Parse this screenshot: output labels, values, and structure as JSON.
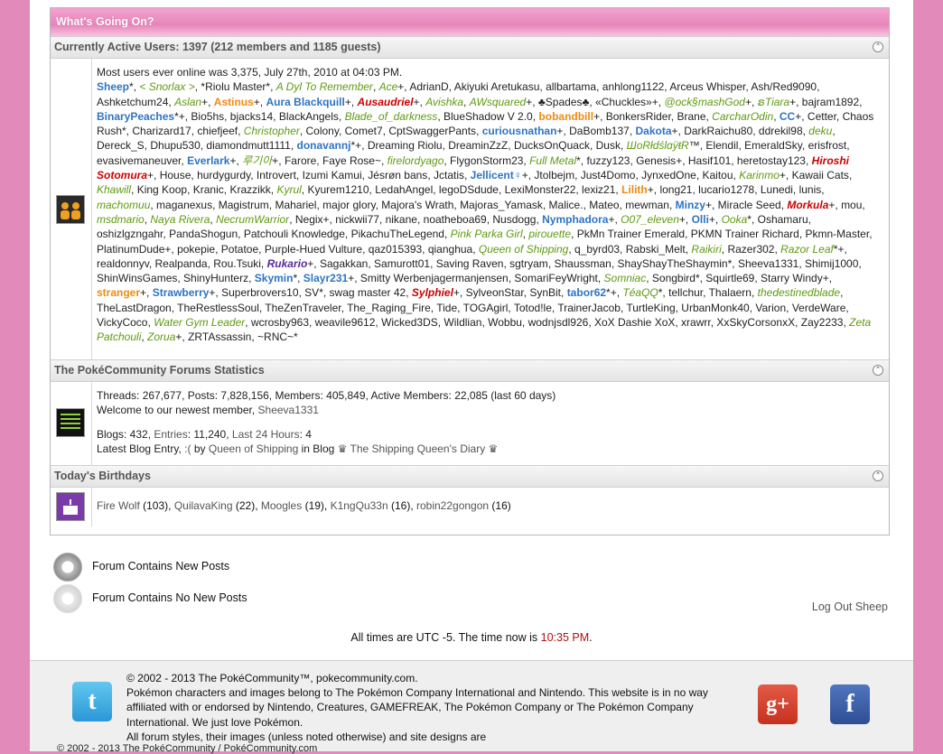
{
  "whats_going_on": {
    "title": "What's Going On?"
  },
  "active_users": {
    "header": "Currently Active Users: 1397 (212 members and 1185 guests)",
    "most_ever": "Most users ever online was 3,375, July 27th, 2010 at 04:03 PM.",
    "users": [
      {
        "t": "Sheep",
        "c": "b",
        "s": "*, "
      },
      {
        "t": "< Snorlax >",
        "c": "g",
        "s": ", "
      },
      {
        "t": "*Riolu Master*",
        "c": "",
        "s": ", "
      },
      {
        "t": "A Dyl To Remember",
        "c": "g",
        "s": ", "
      },
      {
        "t": "Ace",
        "c": "g",
        "s": "+, "
      },
      {
        "t": "AdrianD",
        "c": "",
        "s": ", "
      },
      {
        "t": "Akiyuki Aretukasu",
        "c": "",
        "s": ", "
      },
      {
        "t": "allbartama",
        "c": "",
        "s": ", "
      },
      {
        "t": "anhlong1122",
        "c": "",
        "s": ", "
      },
      {
        "t": "Arceus Whisper",
        "c": "",
        "s": ", "
      },
      {
        "t": "Ash/Red9090",
        "c": "",
        "s": ", "
      },
      {
        "t": "Ashketchum24",
        "c": "",
        "s": ", "
      },
      {
        "t": "Aslan",
        "c": "g",
        "s": "+, "
      },
      {
        "t": "Astinus",
        "c": "o",
        "s": "+, "
      },
      {
        "t": "Aura Blackquill",
        "c": "b",
        "s": "+, "
      },
      {
        "t": "Ausaudriel",
        "c": "r",
        "s": "+, "
      },
      {
        "t": "Avishka",
        "c": "g",
        "s": ", "
      },
      {
        "t": "AWsquared",
        "c": "g",
        "s": "+, "
      },
      {
        "t": "♣Spades♣",
        "c": "",
        "s": ", "
      },
      {
        "t": "«Chuckles»",
        "c": "",
        "s": "+, "
      },
      {
        "t": "@ock§mashGod",
        "c": "g",
        "s": "+, "
      },
      {
        "t": "ຣTiara",
        "c": "g",
        "s": "+, "
      },
      {
        "t": "bajram1892",
        "c": "",
        "s": ", "
      },
      {
        "t": "BinaryPeaches",
        "c": "b",
        "s": "*+, "
      },
      {
        "t": "Bio5hs",
        "c": "",
        "s": ", "
      },
      {
        "t": "bjacks14",
        "c": "",
        "s": ", "
      },
      {
        "t": "BlackAngels",
        "c": "",
        "s": ", "
      },
      {
        "t": "Blade_of_darkness",
        "c": "g",
        "s": ", "
      },
      {
        "t": "BlueShadow V 2.0",
        "c": "",
        "s": ", "
      },
      {
        "t": "bobandbill",
        "c": "o",
        "s": "+, "
      },
      {
        "t": "BonkersRider",
        "c": "",
        "s": ", "
      },
      {
        "t": "Brane",
        "c": "",
        "s": ", "
      },
      {
        "t": "CarcharOdin",
        "c": "g",
        "s": ", "
      },
      {
        "t": "CC",
        "c": "b",
        "s": "+, "
      },
      {
        "t": "Cetter",
        "c": "",
        "s": ", "
      },
      {
        "t": "Chaos Rush",
        "c": "",
        "s": "*, "
      },
      {
        "t": "Charizard17",
        "c": "",
        "s": ", "
      },
      {
        "t": "chiefjeef",
        "c": "",
        "s": ", "
      },
      {
        "t": "Christopher",
        "c": "g",
        "s": ", "
      },
      {
        "t": "Colony",
        "c": "",
        "s": ", "
      },
      {
        "t": "Comet7",
        "c": "",
        "s": ", "
      },
      {
        "t": "CptSwaggerPants",
        "c": "",
        "s": ", "
      },
      {
        "t": "curiousnathan",
        "c": "b",
        "s": "+, "
      },
      {
        "t": "DaBomb137",
        "c": "",
        "s": ", "
      },
      {
        "t": "Dakota",
        "c": "b",
        "s": "+, "
      },
      {
        "t": "DarkRaichu80",
        "c": "",
        "s": ", "
      },
      {
        "t": "ddrekil98",
        "c": "",
        "s": ", "
      },
      {
        "t": "deku",
        "c": "g",
        "s": ", "
      },
      {
        "t": "Dereck_S",
        "c": "",
        "s": ", "
      },
      {
        "t": "Dhupu530",
        "c": "",
        "s": ", "
      },
      {
        "t": "diamondmutt1111",
        "c": "",
        "s": ", "
      },
      {
        "t": "donavannj",
        "c": "b",
        "s": "*+, "
      },
      {
        "t": "Dreaming Riolu",
        "c": "",
        "s": ", "
      },
      {
        "t": "DreaminZzZ",
        "c": "",
        "s": ", "
      },
      {
        "t": "DucksOnQuack",
        "c": "",
        "s": ", "
      },
      {
        "t": "Dusk",
        "c": "",
        "s": ", "
      },
      {
        "t": "ШoRłdślɑÿŧR",
        "c": "g",
        "s": "™, "
      },
      {
        "t": "Elendil",
        "c": "",
        "s": ", "
      },
      {
        "t": "EmeraldSky",
        "c": "",
        "s": ", "
      },
      {
        "t": "erisfrost",
        "c": "",
        "s": ", "
      },
      {
        "t": "evasivemaneuver",
        "c": "",
        "s": ", "
      },
      {
        "t": "Everlark",
        "c": "b",
        "s": "+, "
      },
      {
        "t": "루기아",
        "c": "g",
        "s": "+, "
      },
      {
        "t": "Farore",
        "c": "",
        "s": ", "
      },
      {
        "t": "Faye Rose~",
        "c": "",
        "s": ", "
      },
      {
        "t": "firelordyago",
        "c": "g",
        "s": ", "
      },
      {
        "t": "FlygonStorm23",
        "c": "",
        "s": ", "
      },
      {
        "t": "Full Metal",
        "c": "g",
        "s": "*, "
      },
      {
        "t": "fuzzy123",
        "c": "",
        "s": ", "
      },
      {
        "t": "Genesis",
        "c": "",
        "s": "+, "
      },
      {
        "t": "Hasif101",
        "c": "",
        "s": ", "
      },
      {
        "t": "heretostay123",
        "c": "",
        "s": ", "
      },
      {
        "t": "Hiroshi Sotomura",
        "c": "r",
        "s": "+, "
      },
      {
        "t": "House",
        "c": "",
        "s": ", "
      },
      {
        "t": "hurdygurdy",
        "c": "",
        "s": ", "
      },
      {
        "t": "Introvert",
        "c": "",
        "s": ", "
      },
      {
        "t": "Izumi",
        "c": "",
        "s": " "
      },
      {
        "t": "Kamui",
        "c": "",
        "s": ", "
      },
      {
        "t": "Jésrøn bans",
        "c": "",
        "s": ", "
      },
      {
        "t": "Jctatis",
        "c": "",
        "s": ", "
      },
      {
        "t": "Jellicent♀",
        "c": "b",
        "s": "+, "
      },
      {
        "t": "Jtolbejm",
        "c": "",
        "s": ", "
      },
      {
        "t": "Just4Domo",
        "c": "",
        "s": ", "
      },
      {
        "t": "JynxedOne",
        "c": "",
        "s": ", "
      },
      {
        "t": "Kaitou",
        "c": "",
        "s": ", "
      },
      {
        "t": "Karinmo",
        "c": "g",
        "s": "+, "
      },
      {
        "t": "Kawaii Cats",
        "c": "",
        "s": ", "
      },
      {
        "t": "Khawill",
        "c": "g",
        "s": ", "
      },
      {
        "t": "King Koop",
        "c": "",
        "s": ", "
      },
      {
        "t": "Kranic",
        "c": "",
        "s": ", "
      },
      {
        "t": "Krazzikk",
        "c": "",
        "s": ", "
      },
      {
        "t": "Kyrul",
        "c": "g",
        "s": ", "
      },
      {
        "t": "Kyurem1210",
        "c": "",
        "s": ", "
      },
      {
        "t": "LedahAngel",
        "c": "",
        "s": ", "
      },
      {
        "t": "legoDSdude",
        "c": "",
        "s": ", "
      },
      {
        "t": "LexiMonster22",
        "c": "",
        "s": ", "
      },
      {
        "t": "lexiz21",
        "c": "",
        "s": ", "
      },
      {
        "t": "Lilith",
        "c": "o",
        "s": "+, "
      },
      {
        "t": "long21",
        "c": "",
        "s": ", "
      },
      {
        "t": "lucario1278",
        "c": "",
        "s": ", "
      },
      {
        "t": "Lunedi",
        "c": "",
        "s": ", "
      },
      {
        "t": "lunis",
        "c": "",
        "s": ", "
      },
      {
        "t": "machomuu",
        "c": "g",
        "s": ", "
      },
      {
        "t": "maganexus",
        "c": "",
        "s": ", "
      },
      {
        "t": "Magistrum",
        "c": "",
        "s": ", "
      },
      {
        "t": "Mahariel",
        "c": "",
        "s": ", "
      },
      {
        "t": "major glory",
        "c": "",
        "s": ", "
      },
      {
        "t": "Majora's Wrath",
        "c": "",
        "s": ", "
      },
      {
        "t": "Majoras_Yamask",
        "c": "",
        "s": ", "
      },
      {
        "t": "Malice.",
        "c": "",
        "s": ", "
      },
      {
        "t": "Mateo",
        "c": "",
        "s": ", "
      },
      {
        "t": "mewman",
        "c": "",
        "s": ", "
      },
      {
        "t": "Minzy",
        "c": "b",
        "s": "+, "
      },
      {
        "t": "Miracle Seed",
        "c": "",
        "s": ", "
      },
      {
        "t": "Morkula",
        "c": "r",
        "s": "+, "
      },
      {
        "t": "mou",
        "c": "",
        "s": ", "
      },
      {
        "t": "msdmario",
        "c": "g",
        "s": ", "
      },
      {
        "t": "Naya Rivera",
        "c": "g",
        "s": ", "
      },
      {
        "t": "NecrumWarrior",
        "c": "g",
        "s": ", "
      },
      {
        "t": "Negix",
        "c": "",
        "s": "+, "
      },
      {
        "t": "nickwii77",
        "c": "",
        "s": ", "
      },
      {
        "t": "nikane",
        "c": "",
        "s": ", "
      },
      {
        "t": "noatheboa69",
        "c": "",
        "s": ", "
      },
      {
        "t": "Nusdogg",
        "c": "",
        "s": ", "
      },
      {
        "t": "Nymphadora",
        "c": "b",
        "s": "+, "
      },
      {
        "t": "O07_eleven",
        "c": "g",
        "s": "+, "
      },
      {
        "t": "Olli",
        "c": "b",
        "s": "+, "
      },
      {
        "t": "Ooka",
        "c": "g",
        "s": "*, "
      },
      {
        "t": "Oshamaru",
        "c": "",
        "s": ", "
      },
      {
        "t": "oshizlgzngahr",
        "c": "",
        "s": ", "
      },
      {
        "t": "PandaShogun",
        "c": "",
        "s": ", "
      },
      {
        "t": "Patchouli Knowledge",
        "c": "",
        "s": ", "
      },
      {
        "t": "PikachuTheLegend",
        "c": "",
        "s": ", "
      },
      {
        "t": "Pink Parka Girl",
        "c": "g",
        "s": ", "
      },
      {
        "t": "pirouette",
        "c": "g",
        "s": ", "
      },
      {
        "t": "PkMn Trainer Emerald",
        "c": "",
        "s": ", "
      },
      {
        "t": "PKMN Trainer Richard",
        "c": "",
        "s": ", "
      },
      {
        "t": "Pkmn-Master",
        "c": "",
        "s": ", "
      },
      {
        "t": "PlatinumDude",
        "c": "",
        "s": "+, "
      },
      {
        "t": "pokepie",
        "c": "",
        "s": ", "
      },
      {
        "t": "Potatoe",
        "c": "",
        "s": ", "
      },
      {
        "t": "Purple-Hued Vulture",
        "c": "",
        "s": ", "
      },
      {
        "t": "qaz015393",
        "c": "",
        "s": ", "
      },
      {
        "t": "qianghua",
        "c": "",
        "s": ", "
      },
      {
        "t": "Queen of Shipping",
        "c": "g",
        "s": ", "
      },
      {
        "t": "q_byrd03",
        "c": "",
        "s": ", "
      },
      {
        "t": "Rabski_Melt",
        "c": "",
        "s": ", "
      },
      {
        "t": "Raikiri",
        "c": "g",
        "s": ", "
      },
      {
        "t": "Razer302",
        "c": "",
        "s": ", "
      },
      {
        "t": "Razor Leaf",
        "c": "g",
        "s": "*+, "
      },
      {
        "t": "realdonnyv",
        "c": "",
        "s": ", "
      },
      {
        "t": "Realpanda",
        "c": "",
        "s": ", "
      },
      {
        "t": "Rou.Tsuki",
        "c": "",
        "s": ", "
      },
      {
        "t": "Rukario",
        "c": "p",
        "s": "+, "
      },
      {
        "t": "Sagakkan",
        "c": "",
        "s": ", "
      },
      {
        "t": "Samurott01",
        "c": "",
        "s": ", "
      },
      {
        "t": "Saving Raven",
        "c": "",
        "s": ", "
      },
      {
        "t": "sgtryam",
        "c": "",
        "s": ", "
      },
      {
        "t": "Shaussman",
        "c": "",
        "s": ", "
      },
      {
        "t": "ShayShayTheShaymin",
        "c": "",
        "s": "*, "
      },
      {
        "t": "Sheeva1331",
        "c": "",
        "s": ", "
      },
      {
        "t": "Shimij1000",
        "c": "",
        "s": ", "
      },
      {
        "t": "ShinWinsGames",
        "c": "",
        "s": ", "
      },
      {
        "t": "ShinyHunterz",
        "c": "",
        "s": ", "
      },
      {
        "t": "Skymin",
        "c": "b",
        "s": "*, "
      },
      {
        "t": "Slayr231",
        "c": "b",
        "s": "+, "
      },
      {
        "t": "Smitty Werbenjagermanjensen",
        "c": "",
        "s": ", "
      },
      {
        "t": "SomariFeyWright",
        "c": "",
        "s": ", "
      },
      {
        "t": "Somniac",
        "c": "g",
        "s": ", "
      },
      {
        "t": "Songbird",
        "c": "",
        "s": "*, "
      },
      {
        "t": "Squirtle69",
        "c": "",
        "s": ", "
      },
      {
        "t": "Starry Windy",
        "c": "",
        "s": "+, "
      },
      {
        "t": "stranger",
        "c": "o",
        "s": "+, "
      },
      {
        "t": "Strawberry",
        "c": "b",
        "s": "+, "
      },
      {
        "t": "Superbrovers10",
        "c": "",
        "s": ", "
      },
      {
        "t": "SV",
        "c": "",
        "s": "*, "
      },
      {
        "t": "swag master 42",
        "c": "",
        "s": ", "
      },
      {
        "t": "Sylphiel",
        "c": "r",
        "s": "+, "
      },
      {
        "t": "SylveonStar",
        "c": "",
        "s": ", "
      },
      {
        "t": "SynBit",
        "c": "",
        "s": ", "
      },
      {
        "t": "tabor62",
        "c": "b",
        "s": "*+, "
      },
      {
        "t": "TéaQQ",
        "c": "g",
        "s": "*, "
      },
      {
        "t": "tellchur",
        "c": "",
        "s": ", "
      },
      {
        "t": "Thalaern",
        "c": "",
        "s": ", "
      },
      {
        "t": "thedestinedblade",
        "c": "g",
        "s": ", "
      },
      {
        "t": "TheLastDragon",
        "c": "",
        "s": ", "
      },
      {
        "t": "TheRestlessSoul",
        "c": "",
        "s": ", "
      },
      {
        "t": "TheZenTraveler",
        "c": "",
        "s": ", "
      },
      {
        "t": "The_Raging_Fire",
        "c": "",
        "s": ", "
      },
      {
        "t": "Tide",
        "c": "",
        "s": ", "
      },
      {
        "t": "TOGAgirl",
        "c": "",
        "s": ", "
      },
      {
        "t": "Totod!le",
        "c": "",
        "s": ", "
      },
      {
        "t": "TrainerJacob",
        "c": "",
        "s": ", "
      },
      {
        "t": "TurtleKing",
        "c": "",
        "s": ", "
      },
      {
        "t": "UrbanMonk40",
        "c": "",
        "s": ", "
      },
      {
        "t": "Varion",
        "c": "",
        "s": ", "
      },
      {
        "t": "VerdeWare",
        "c": "",
        "s": ", "
      },
      {
        "t": "VickyCoco",
        "c": "",
        "s": ", "
      },
      {
        "t": "Water Gym Leader",
        "c": "g",
        "s": ", "
      },
      {
        "t": "wcrosby963",
        "c": "",
        "s": ", "
      },
      {
        "t": "weavile9612",
        "c": "",
        "s": ", "
      },
      {
        "t": "Wicked3DS",
        "c": "",
        "s": ", "
      },
      {
        "t": "Wildlian",
        "c": "",
        "s": ", "
      },
      {
        "t": "Wobbu",
        "c": "",
        "s": ", "
      },
      {
        "t": "wodnjsdl926",
        "c": "",
        "s": ", "
      },
      {
        "t": "XoX Dashie XoX",
        "c": "",
        "s": ", "
      },
      {
        "t": "xrawrr",
        "c": "",
        "s": ", "
      },
      {
        "t": "XxSkyCorsonxX",
        "c": "",
        "s": ", "
      },
      {
        "t": "Zay2233",
        "c": "",
        "s": ", "
      },
      {
        "t": "Zeta Patchouli",
        "c": "g",
        "s": ", "
      },
      {
        "t": "Zorua",
        "c": "g",
        "s": "+, "
      },
      {
        "t": "ZRTAssassin",
        "c": "",
        "s": ", "
      },
      {
        "t": "~RNC~",
        "c": "",
        "s": "*"
      }
    ]
  },
  "stats": {
    "header": "The PokéCommunity Forums Statistics",
    "line1": "Threads: 267,677, Posts: 7,828,156, Members: 405,849, Active Members: 22,085 (last 60 days)",
    "welcome_prefix": "Welcome to our newest member, ",
    "newest_member": "Sheeva1331",
    "blogs_prefix": "Blogs: 432, ",
    "entries_label": "Entries",
    "entries_value": ": 11,240, ",
    "last24_label": "Last 24 Hours",
    "last24_value": ": 4",
    "latest_prefix": "Latest Blog Entry, ",
    "latest_entry": ":(",
    "by": " by ",
    "latest_author": "Queen of Shipping",
    "in_blog": " in Blog ",
    "blog_name": "♛ The Shipping Queen's Diary ♛"
  },
  "birthdays": {
    "header": "Today's Birthdays",
    "list": [
      {
        "name": "Fire Wolf",
        "age": "(103)"
      },
      {
        "name": "QuilavaKing",
        "age": "(22)"
      },
      {
        "name": "Moogles",
        "age": "(19)"
      },
      {
        "name": "K1ngQu33n",
        "age": "(16)"
      },
      {
        "name": "robin22gongon",
        "age": "(16)"
      }
    ]
  },
  "legend": {
    "new_posts": "Forum Contains New Posts",
    "no_new_posts": "Forum Contains No New Posts"
  },
  "logout": "Log Out Sheep",
  "time": {
    "prefix": "All times are UTC -5. The time now is ",
    "value": "10:35 PM",
    "suffix": "."
  },
  "footer": {
    "copyright": "© 2002 - 2013 The PokéCommunity™, pokecommunity.com.",
    "disclaimer": "Pokémon characters and images belong to The Pokémon Company International and Nintendo. This website is in no way affiliated with or endorsed by Nintendo, Creatures, GAMEFREAK, The Pokémon Company or The Pokémon Company International. We just love Pokémon.",
    "styles": "All forum styles, their images (unless noted otherwise) and site designs are",
    "bottom": "© 2002 - 2013 The PokéCommunity / PokéCommunity.com"
  },
  "icons": {
    "users": "users-icon",
    "stats": "stats-icon",
    "birthday": "cake-icon"
  },
  "colors": {
    "pink": "#e28bbb",
    "blue": "#2f74c2",
    "green": "#5f9a12",
    "orange": "#f08a0f",
    "red": "#cc0000"
  }
}
